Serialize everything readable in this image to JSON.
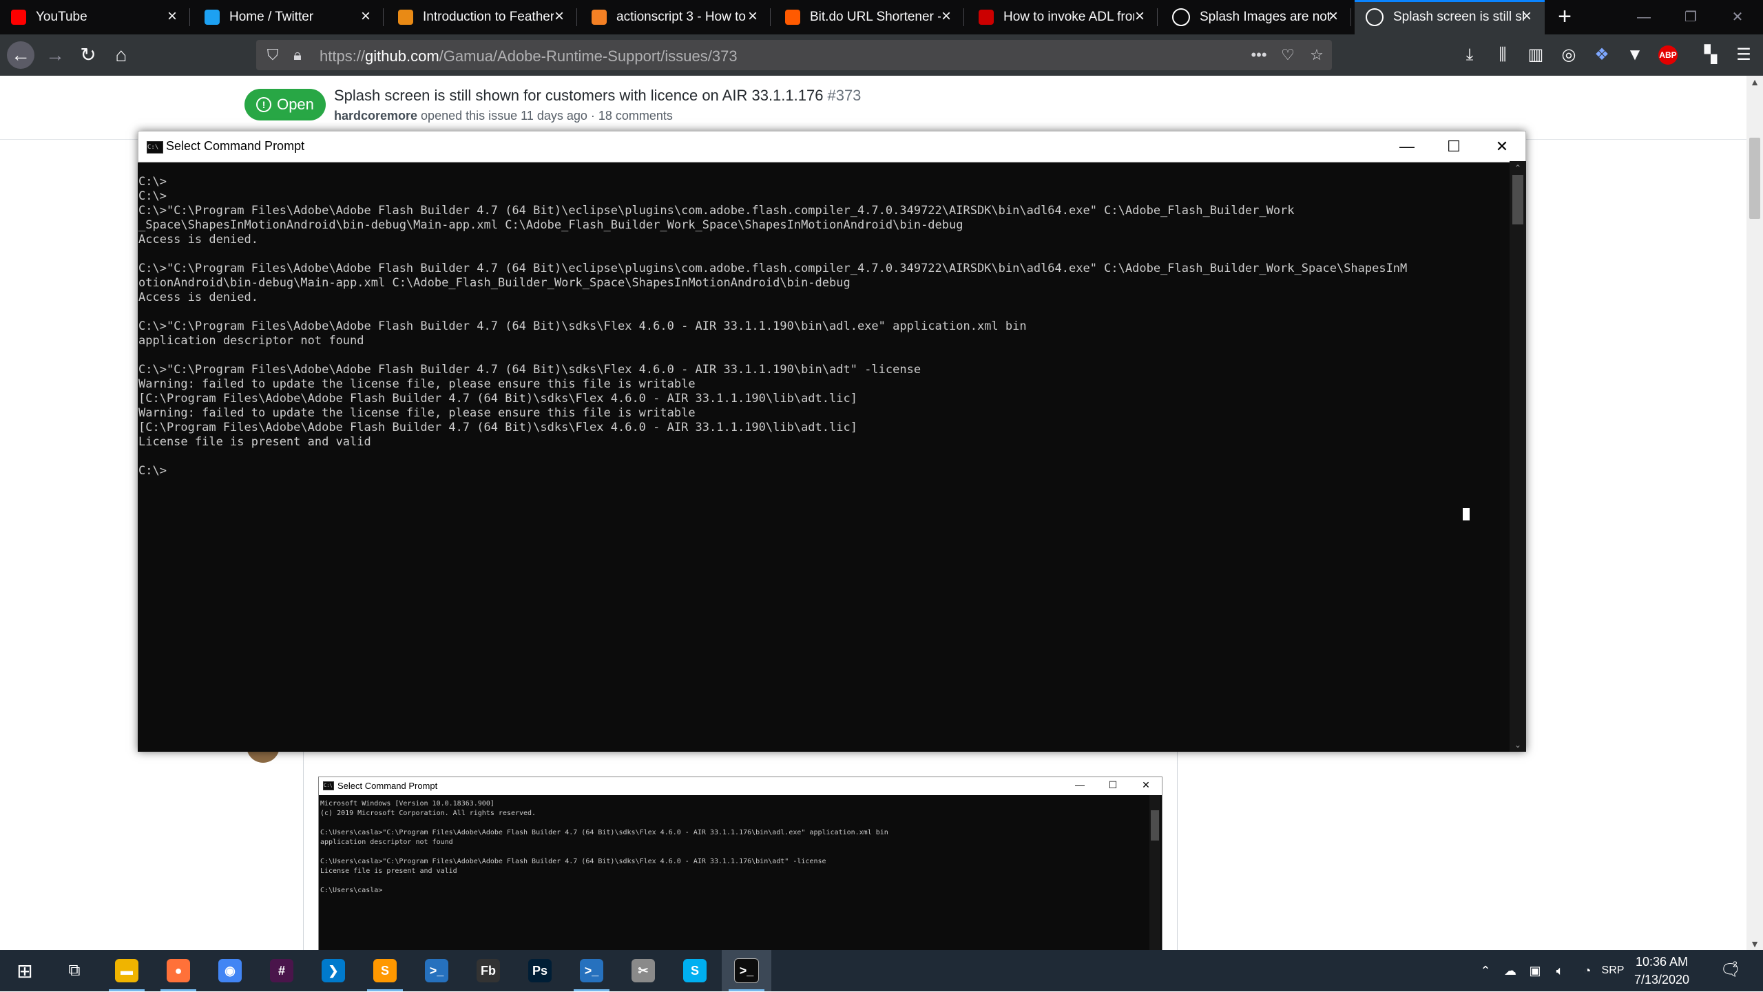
{
  "browser": {
    "tabs": [
      {
        "label": "YouTube",
        "icon": "youtube-icon",
        "color": "#ff0000"
      },
      {
        "label": "Home / Twitter",
        "icon": "twitter-icon",
        "color": "#1da1f2"
      },
      {
        "label": "Introduction to Feathers",
        "icon": "feathers-icon",
        "color": "#e98a15"
      },
      {
        "label": "actionscript 3 - How to",
        "icon": "stackoverflow-icon",
        "color": "#f48024"
      },
      {
        "label": "Bit.do URL Shortener - S",
        "icon": "bitdo-icon",
        "color": "#ff5a00"
      },
      {
        "label": "How to invoke ADL from",
        "icon": "adl-icon",
        "color": "#cc0000"
      },
      {
        "label": "Splash Images are not d",
        "icon": "github-icon",
        "color": "#ffffff"
      },
      {
        "label": "Splash screen is still sho",
        "icon": "github-icon",
        "color": "#ffffff",
        "active": true
      }
    ],
    "url_prefix": "https://",
    "url_host": "github.com",
    "url_path": "/Gamua/Adobe-Runtime-Support/issues/373"
  },
  "issue": {
    "state": "Open",
    "title": "Splash screen is still shown for customers with licence on AIR 33.1.1.176",
    "number": "#373",
    "author": "hardcoremore",
    "meta": " opened this issue 11 days ago · 18 comments"
  },
  "cmd_main": {
    "title": "Select Command Prompt",
    "lines": [
      "C:\\>",
      "C:\\>",
      "C:\\>\"C:\\Program Files\\Adobe\\Adobe Flash Builder 4.7 (64 Bit)\\eclipse\\plugins\\com.adobe.flash.compiler_4.7.0.349722\\AIRSDK\\bin\\adl64.exe\" C:\\Adobe_Flash_Builder_Work",
      "_Space\\ShapesInMotionAndroid\\bin-debug\\Main-app.xml C:\\Adobe_Flash_Builder_Work_Space\\ShapesInMotionAndroid\\bin-debug",
      "Access is denied.",
      "",
      "C:\\>\"C:\\Program Files\\Adobe\\Adobe Flash Builder 4.7 (64 Bit)\\eclipse\\plugins\\com.adobe.flash.compiler_4.7.0.349722\\AIRSDK\\bin\\adl64.exe\" C:\\Adobe_Flash_Builder_Work_Space\\ShapesInM",
      "otionAndroid\\bin-debug\\Main-app.xml C:\\Adobe_Flash_Builder_Work_Space\\ShapesInMotionAndroid\\bin-debug",
      "Access is denied.",
      "",
      "C:\\>\"C:\\Program Files\\Adobe\\Adobe Flash Builder 4.7 (64 Bit)\\sdks\\Flex 4.6.0 - AIR 33.1.1.190\\bin\\adl.exe\" application.xml bin",
      "application descriptor not found",
      "",
      "C:\\>\"C:\\Program Files\\Adobe\\Adobe Flash Builder 4.7 (64 Bit)\\sdks\\Flex 4.6.0 - AIR 33.1.1.190\\bin\\adt\" -license",
      "Warning: failed to update the license file, please ensure this file is writable",
      "[C:\\Program Files\\Adobe\\Adobe Flash Builder 4.7 (64 Bit)\\sdks\\Flex 4.6.0 - AIR 33.1.1.190\\lib\\adt.lic]",
      "Warning: failed to update the license file, please ensure this file is writable",
      "[C:\\Program Files\\Adobe\\Adobe Flash Builder 4.7 (64 Bit)\\sdks\\Flex 4.6.0 - AIR 33.1.1.190\\lib\\adt.lic]",
      "License file is present and valid",
      "",
      "C:\\>"
    ]
  },
  "cmd_embedded": {
    "title": "Select Command Prompt",
    "lines": [
      "Microsoft Windows [Version 10.0.18363.900]",
      "(c) 2019 Microsoft Corporation. All rights reserved.",
      "",
      "C:\\Users\\casla>\"C:\\Program Files\\Adobe\\Adobe Flash Builder 4.7 (64 Bit)\\sdks\\Flex 4.6.0 - AIR 33.1.1.176\\bin\\adl.exe\" application.xml bin",
      "application descriptor not found",
      "",
      "C:\\Users\\casla>\"C:\\Program Files\\Adobe\\Adobe Flash Builder 4.7 (64 Bit)\\sdks\\Flex 4.6.0 - AIR 33.1.1.176\\bin\\adt\" -license",
      "License file is present and valid",
      "",
      "C:\\Users\\casla>"
    ]
  },
  "taskbar": {
    "apps": [
      {
        "name": "file-explorer-icon",
        "glyph": "▬",
        "color": "#f0b400",
        "running": true
      },
      {
        "name": "firefox-icon",
        "glyph": "●",
        "color": "#ff7139",
        "running": true
      },
      {
        "name": "chrome-icon",
        "glyph": "◉",
        "color": "#4285f4",
        "running": false
      },
      {
        "name": "slack-icon",
        "glyph": "#",
        "color": "#4a154b",
        "running": false
      },
      {
        "name": "vscode-icon",
        "glyph": "❯",
        "color": "#007acc",
        "running": false
      },
      {
        "name": "sublime-text-icon",
        "glyph": "S",
        "color": "#ff9800",
        "running": true
      },
      {
        "name": "powershell-icon",
        "glyph": ">_",
        "color": "#2671be",
        "running": false
      },
      {
        "name": "flash-builder-icon",
        "glyph": "Fb",
        "color": "#333333",
        "running": false
      },
      {
        "name": "photoshop-icon",
        "glyph": "Ps",
        "color": "#001e36",
        "running": false
      },
      {
        "name": "powershell-ise-icon",
        "glyph": ">_",
        "color": "#2671be",
        "running": true
      },
      {
        "name": "snipping-tool-icon",
        "glyph": "✂",
        "color": "#8a8a8a",
        "running": false
      },
      {
        "name": "skype-icon",
        "glyph": "S",
        "color": "#00aff0",
        "running": false
      },
      {
        "name": "command-prompt-icon",
        "glyph": ">_",
        "color": "#0c0c0c",
        "running": true,
        "active": true
      }
    ],
    "language": "SRP",
    "time": "10:36 AM",
    "date": "7/13/2020",
    "notifications": "2"
  }
}
